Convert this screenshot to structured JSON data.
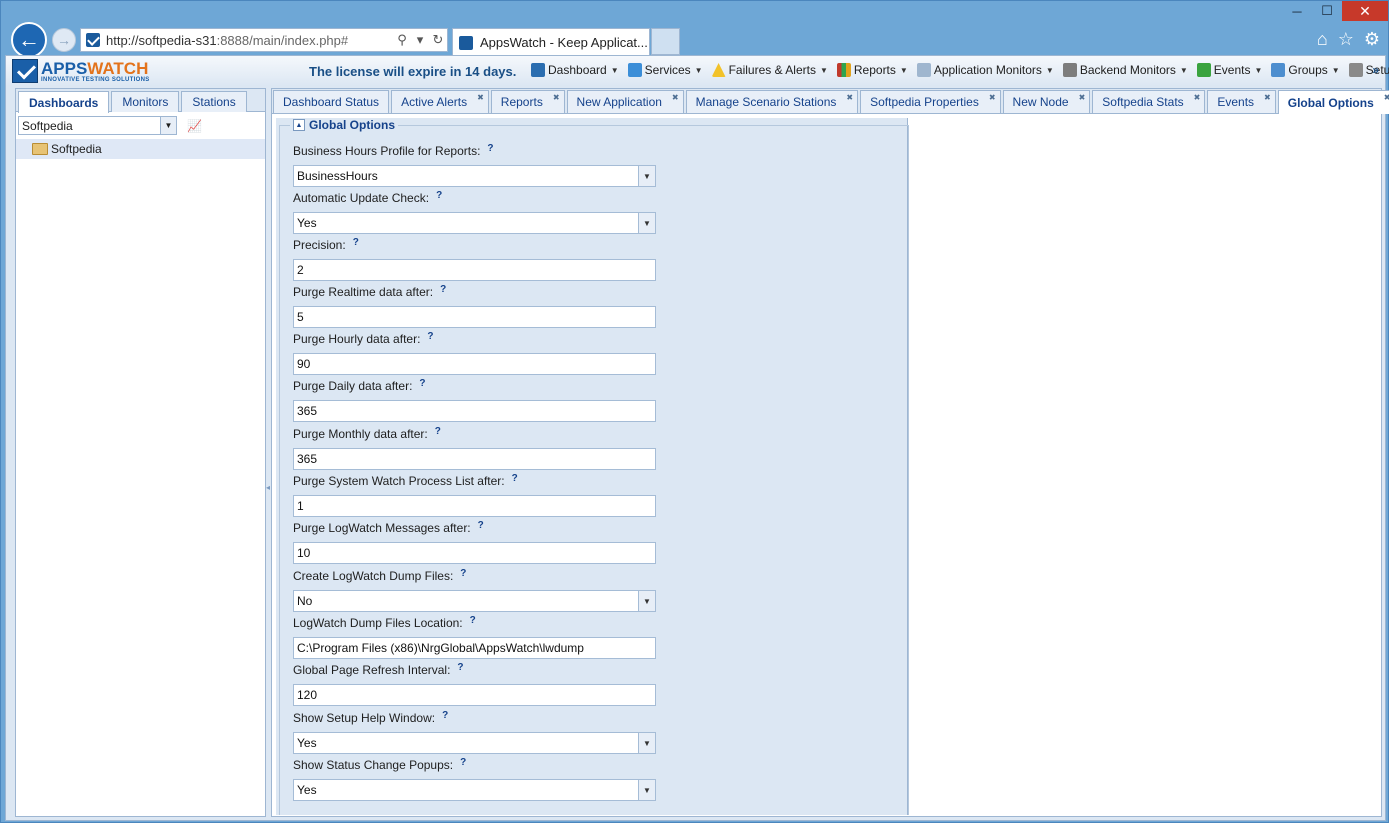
{
  "browser": {
    "url_host": "http://softpedia-s31",
    "url_rest": ":8888/main/index.php#",
    "tab_title": "AppsWatch - Keep Applicat...",
    "win_min": "─",
    "win_max": "☐",
    "win_close": "✕"
  },
  "app": {
    "logo_main": "APPS",
    "logo_accent": "WATCH",
    "logo_tagline": "INNOVATIVE TESTING SOLUTIONS",
    "license": "The license will expire in 14 days.",
    "menu": [
      {
        "label": "Dashboard"
      },
      {
        "label": "Services"
      },
      {
        "label": "Failures & Alerts"
      },
      {
        "label": "Reports"
      },
      {
        "label": "Application Monitors"
      },
      {
        "label": "Backend Monitors"
      },
      {
        "label": "Events"
      },
      {
        "label": "Groups"
      },
      {
        "label": "Setup"
      }
    ],
    "menu_more": "»"
  },
  "left": {
    "tabs": [
      "Dashboards",
      "Monitors",
      "Stations"
    ],
    "selector": "Softpedia",
    "tree_item": "Softpedia"
  },
  "main": {
    "tabs": [
      "Dashboard Status",
      "Active Alerts",
      "Reports",
      "New Application",
      "Manage Scenario Stations",
      "Softpedia Properties",
      "New Node",
      "Softpedia Stats",
      "Events",
      "Global Options"
    ],
    "active_tab": "Global Options"
  },
  "form": {
    "legend": "Global Options",
    "help_mark": "?",
    "fields": [
      {
        "label": "Business Hours Profile for Reports:",
        "value": "BusinessHours"
      },
      {
        "label": "Automatic Update Check:",
        "value": "Yes"
      },
      {
        "label": "Precision:",
        "value": "2"
      },
      {
        "label": "Purge Realtime data after:",
        "value": "5"
      },
      {
        "label": "Purge Hourly data after:",
        "value": "90"
      },
      {
        "label": "Purge Daily data after:",
        "value": "365"
      },
      {
        "label": "Purge Monthly data after:",
        "value": "365"
      },
      {
        "label": "Purge System Watch Process List after:",
        "value": "1"
      },
      {
        "label": "Purge LogWatch Messages after:",
        "value": "10"
      },
      {
        "label": "Create LogWatch Dump Files:",
        "value": "No"
      },
      {
        "label": "LogWatch Dump Files Location:",
        "value": "C:\\Program Files (x86)\\NrgGlobal\\AppsWatch\\lwdump"
      },
      {
        "label": "Global Page Refresh Interval:",
        "value": "120"
      },
      {
        "label": "Show Setup Help Window:",
        "value": "Yes"
      },
      {
        "label": "Show Status Change Popups:",
        "value": "Yes"
      }
    ]
  }
}
